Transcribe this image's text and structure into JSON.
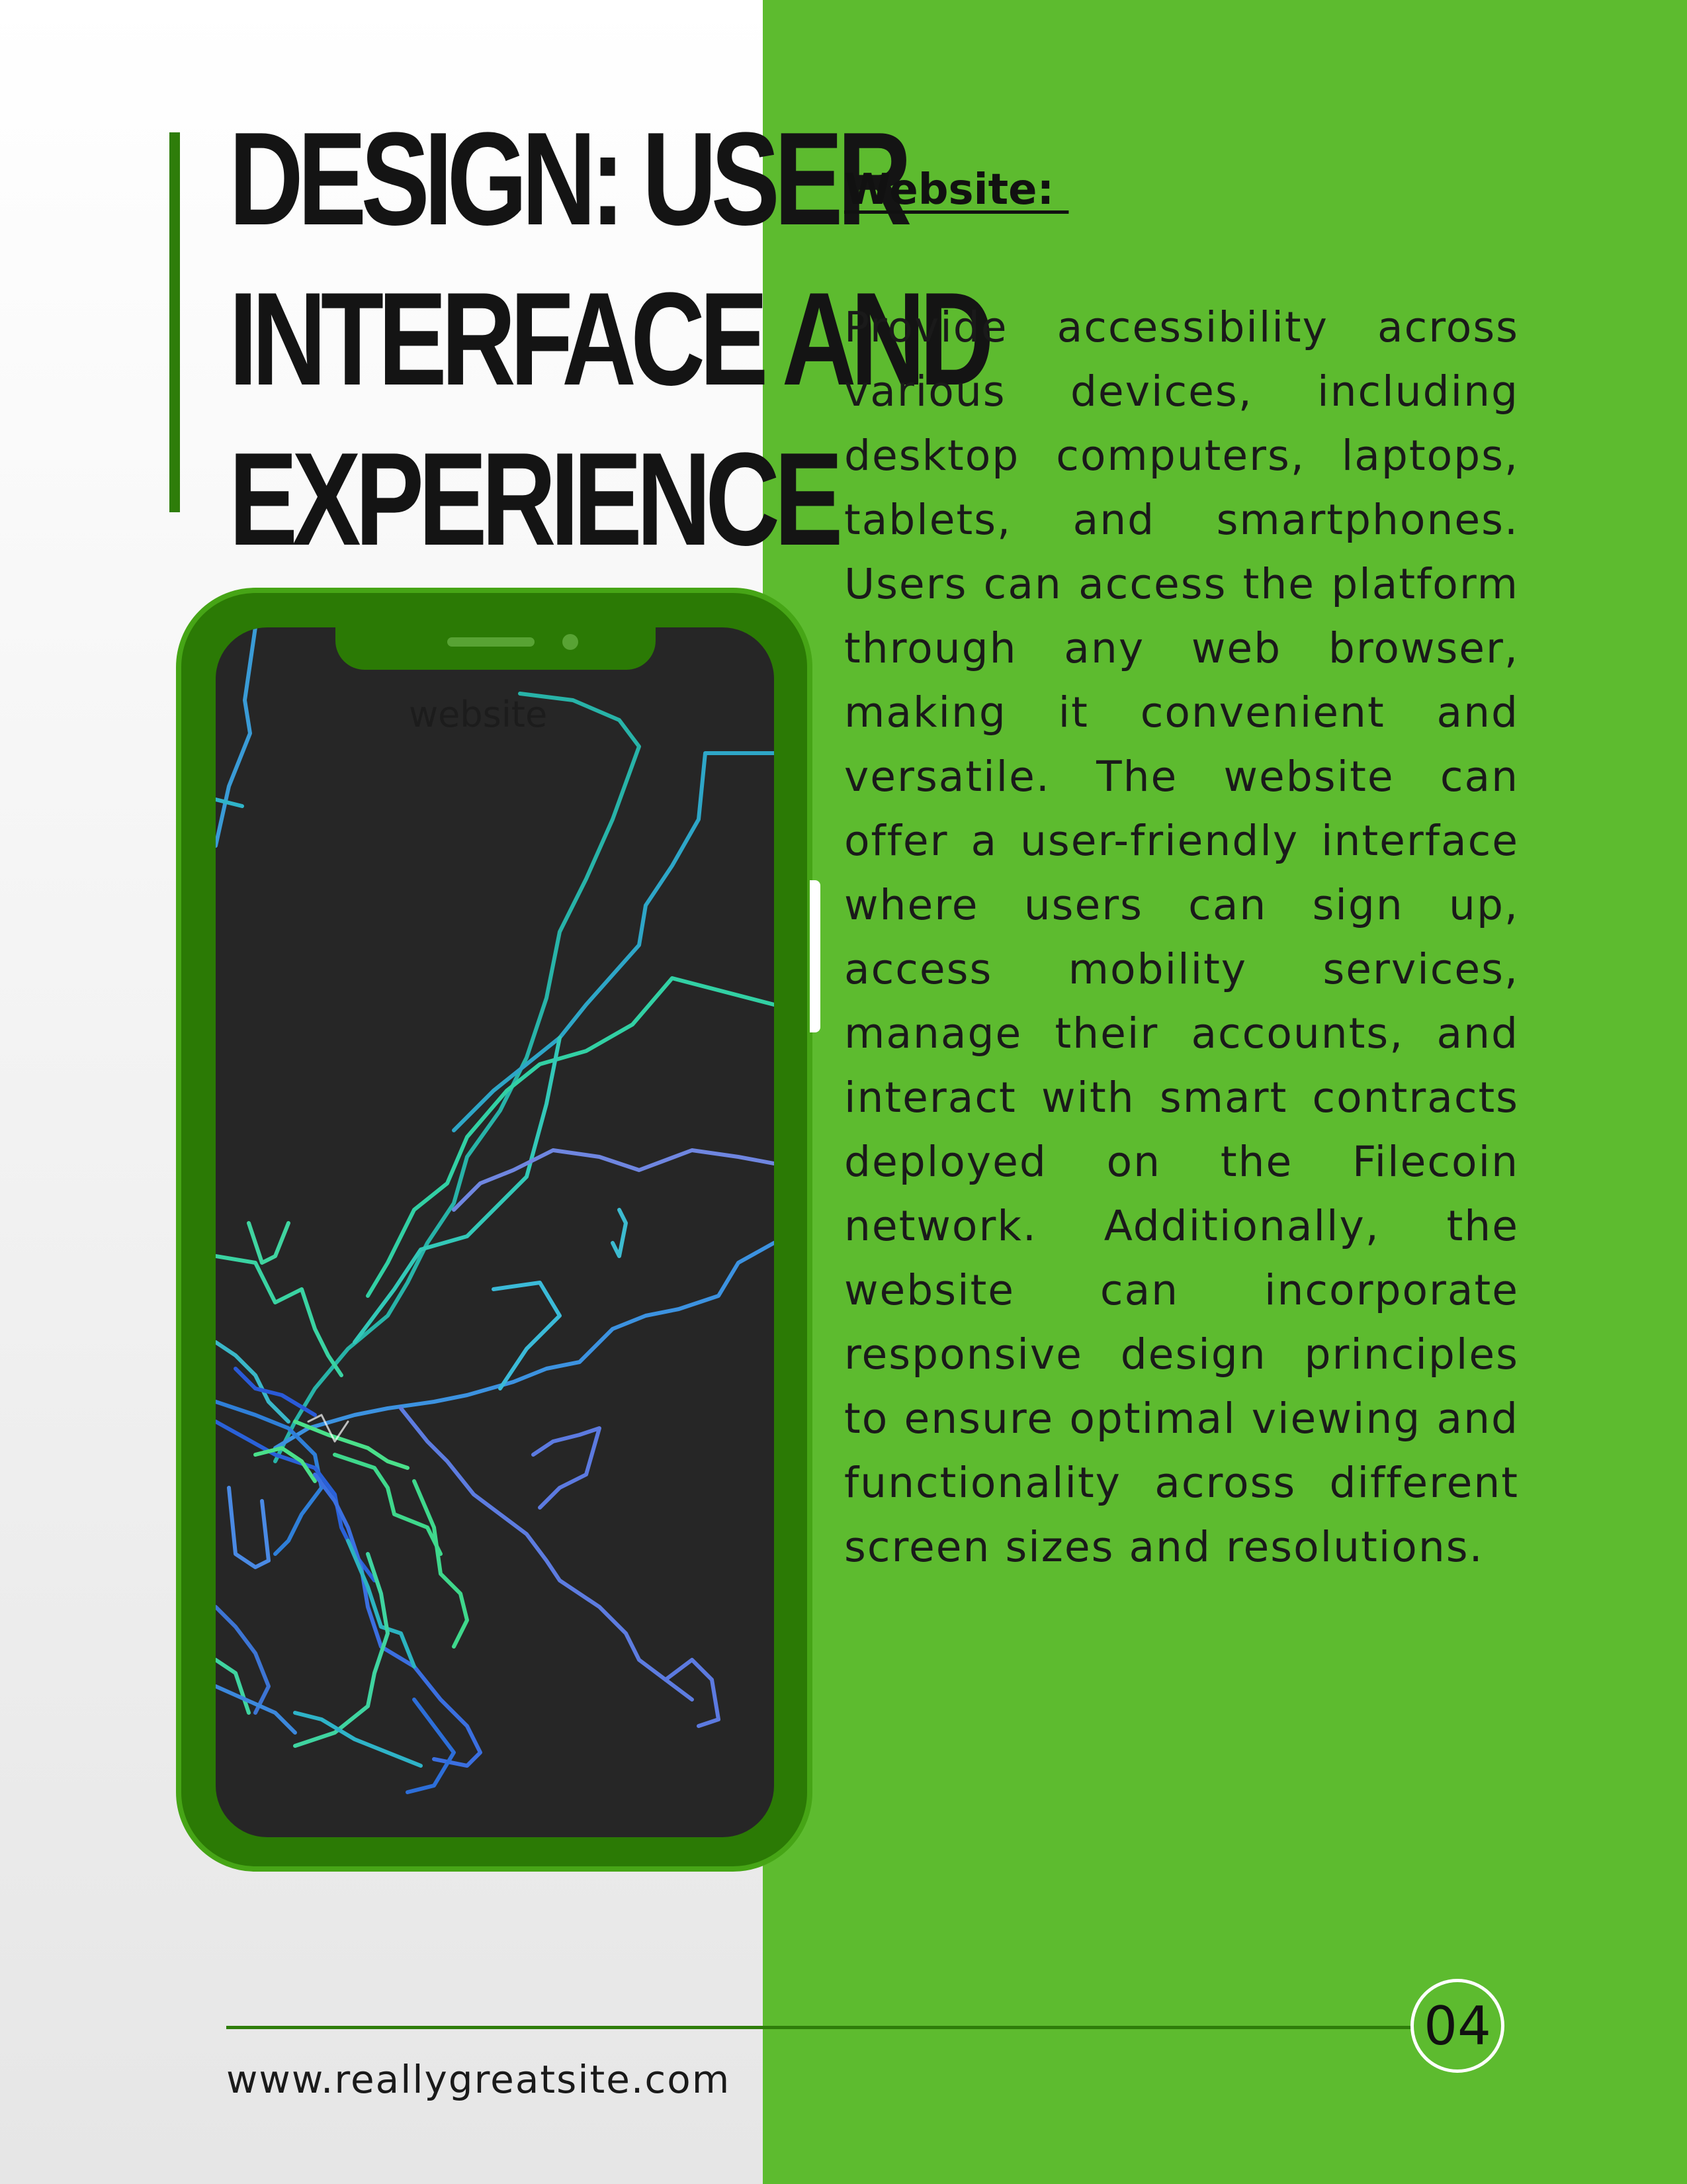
{
  "header": {
    "title_lines": [
      "DESIGN: USER",
      "INTERFACE AND",
      "EXPERIENCE"
    ]
  },
  "section": {
    "heading": "Website: ",
    "body": "Provide accessibility across various devices, including desktop computers, laptops, tablets, and smartphones. Users can access the platform through any web browser, making it convenient and versatile. The website can offer a user-friendly interface where users can sign up, access mobility services, manage their accounts, and interact with smart contracts deployed on the Filecoin network. Additionally, the website can incorporate responsive design principles to ensure optimal viewing and functionality across different screen sizes and resolutions."
  },
  "phone": {
    "screen_label": "website",
    "image_description_icon": "transit-map-image"
  },
  "footer": {
    "url": "www.reallygreatsite.com",
    "page_number": "04"
  },
  "colors": {
    "panel_green": "#5dbb2f",
    "phone_green": "#2b7a05",
    "accent_green": "#2e7d0a",
    "screen_dark": "#262626"
  }
}
